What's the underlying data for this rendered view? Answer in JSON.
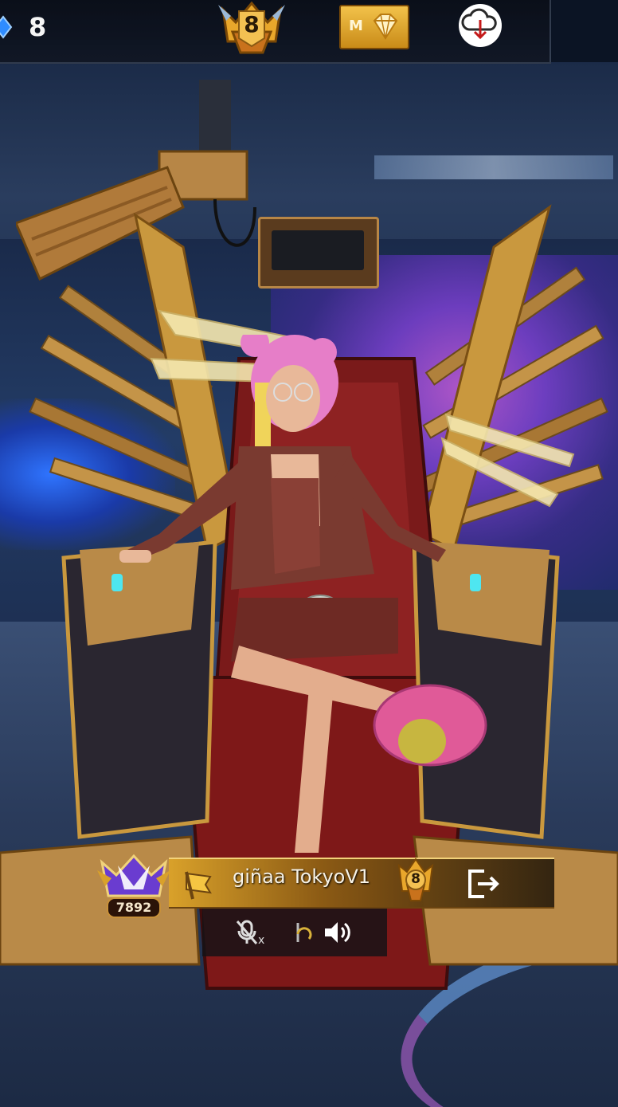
{
  "topbar": {
    "diamond_count": "8",
    "rank_level": "8",
    "membership_label": "M"
  },
  "player": {
    "name": "giñaa TokyoV1",
    "br_score": "7892",
    "rank_level": "8"
  },
  "colors": {
    "gold": "#d9a12a",
    "dark_gold": "#6b4410",
    "diamond_blue": "#2f8cff"
  },
  "icons": {
    "currency": "diamond-icon",
    "download": "cloud-download-icon",
    "exit": "exit-icon",
    "mic": "mic-muted-icon",
    "speaker": "speaker-icon",
    "flag": "flag-icon"
  }
}
